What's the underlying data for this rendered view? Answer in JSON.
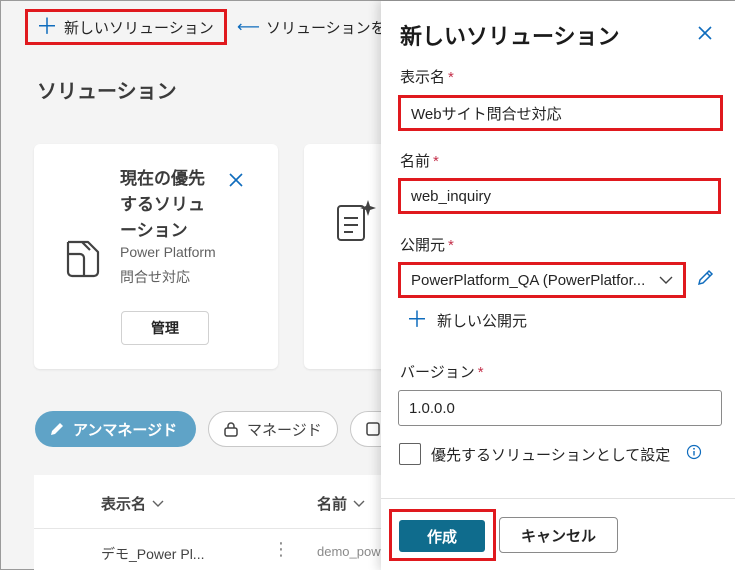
{
  "topbar": {
    "new_solution": "新しいソリューション",
    "import_solution": "ソリューションを"
  },
  "page": {
    "title": "ソリューション"
  },
  "card": {
    "heading": "現在の優先するソリューション",
    "subtitle": "Power Platform問合せ対応",
    "manage": "管理"
  },
  "filters": {
    "unmanaged": "アンマネージド",
    "managed": "マネージド"
  },
  "table": {
    "col_display_name": "表示名",
    "col_name": "名前",
    "rows": [
      {
        "display_name": "デモ_Power Pl...",
        "name": "demo_pow"
      }
    ]
  },
  "panel": {
    "title": "新しいソリューション",
    "display_name_label": "表示名",
    "display_name_value": "Webサイト問合せ対応",
    "name_label": "名前",
    "name_value": "web_inquiry",
    "publisher_label": "公開元",
    "publisher_value": "PowerPlatform_QA (PowerPlatfor...",
    "new_publisher": "新しい公開元",
    "version_label": "バージョン",
    "version_value": "1.0.0.0",
    "preferred_checkbox": "優先するソリューションとして設定",
    "required_mark": "*",
    "create": "作成",
    "cancel": "キャンセル"
  },
  "colors": {
    "accent": "#0f6cbd",
    "primary_button": "#0f6c8d",
    "highlight": "#e0191e",
    "required": "#c4314b"
  }
}
